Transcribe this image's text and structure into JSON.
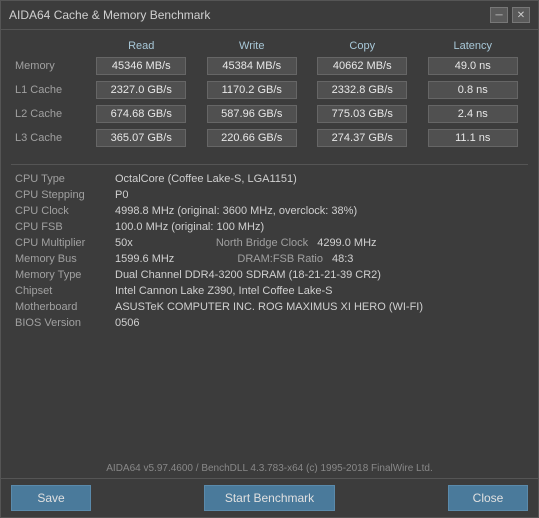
{
  "window": {
    "title": "AIDA64 Cache & Memory Benchmark",
    "minimize_label": "─",
    "close_label": "✕"
  },
  "table": {
    "headers": [
      "",
      "Read",
      "Write",
      "Copy",
      "Latency"
    ],
    "rows": [
      {
        "label": "Memory",
        "read": "45346 MB/s",
        "write": "45384 MB/s",
        "copy": "40662 MB/s",
        "latency": "49.0 ns"
      },
      {
        "label": "L1 Cache",
        "read": "2327.0 GB/s",
        "write": "1170.2 GB/s",
        "copy": "2332.8 GB/s",
        "latency": "0.8 ns"
      },
      {
        "label": "L2 Cache",
        "read": "674.68 GB/s",
        "write": "587.96 GB/s",
        "copy": "775.03 GB/s",
        "latency": "2.4 ns"
      },
      {
        "label": "L3 Cache",
        "read": "365.07 GB/s",
        "write": "220.66 GB/s",
        "copy": "274.37 GB/s",
        "latency": "11.1 ns"
      }
    ]
  },
  "system_info": {
    "cpu_type_label": "CPU Type",
    "cpu_type_value": "OctalCore  (Coffee Lake-S, LGA1151)",
    "cpu_stepping_label": "CPU Stepping",
    "cpu_stepping_value": "P0",
    "cpu_clock_label": "CPU Clock",
    "cpu_clock_value": "4998.8 MHz  (original: 3600 MHz, overclock: 38%)",
    "cpu_fsb_label": "CPU FSB",
    "cpu_fsb_value": "100.0 MHz  (original: 100 MHz)",
    "cpu_multiplier_label": "CPU Multiplier",
    "cpu_multiplier_value": "50x",
    "north_bridge_label": "North Bridge Clock",
    "north_bridge_value": "4299.0 MHz",
    "memory_bus_label": "Memory Bus",
    "memory_bus_value": "1599.6 MHz",
    "dram_fsb_label": "DRAM:FSB Ratio",
    "dram_fsb_value": "48:3",
    "memory_type_label": "Memory Type",
    "memory_type_value": "Dual Channel DDR4-3200 SDRAM  (18-21-21-39 CR2)",
    "chipset_label": "Chipset",
    "chipset_value": "Intel Cannon Lake Z390, Intel Coffee Lake-S",
    "motherboard_label": "Motherboard",
    "motherboard_value": "ASUSTeK COMPUTER INC. ROG MAXIMUS XI HERO (WI-FI)",
    "bios_label": "BIOS Version",
    "bios_value": "0506"
  },
  "footer": {
    "text": "AIDA64 v5.97.4600 / BenchDLL 4.3.783-x64  (c) 1995-2018 FinalWire Ltd."
  },
  "buttons": {
    "save": "Save",
    "start": "Start Benchmark",
    "close": "Close"
  }
}
